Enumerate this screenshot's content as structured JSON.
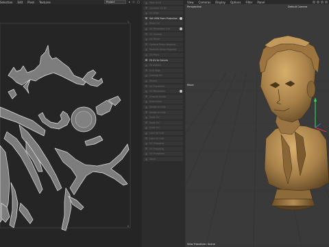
{
  "uv_editor": {
    "menu": [
      "Selection",
      "Edit",
      "Pivot",
      "Textures"
    ],
    "project_select": "Project",
    "axis_labels": {
      "top_right": "1",
      "bottom_right": "0"
    }
  },
  "command_panel": {
    "items": [
      {
        "label": "Pack to Fit",
        "active": false,
        "checked": false
      },
      {
        "label": "Conform UV Fit",
        "active": false,
        "checked": false
      },
      {
        "label": "UV Align",
        "active": false,
        "checked": false
      },
      {
        "label": "Set UVW From Projection",
        "active": true,
        "checked": true
      },
      {
        "label": "Relax UV",
        "active": false,
        "checked": false
      },
      {
        "label": "UV Relaxation Cut",
        "active": false,
        "checked": true
      },
      {
        "label": "UV Unwrap",
        "active": false,
        "checked": false
      },
      {
        "label": "UV Mirror",
        "active": false,
        "checked": false
      },
      {
        "label": "Optimal Relax Mapping",
        "active": false,
        "checked": false
      },
      {
        "label": "Realistic Relax Mapping",
        "active": false,
        "checked": false
      },
      {
        "label": "UV Paint",
        "active": false,
        "checked": false
      },
      {
        "label": "Fit UV to Canvas",
        "active": true,
        "checked": false
      },
      {
        "label": "Straighten",
        "active": false,
        "checked": false
      },
      {
        "label": "Grid Align",
        "active": false,
        "checked": false
      },
      {
        "label": "Overlap UV",
        "active": false,
        "checked": false
      },
      {
        "label": "Rotate",
        "active": false,
        "checked": false
      },
      {
        "label": "UV Transform",
        "active": false,
        "checked": false
      },
      {
        "label": "UV Relaxation",
        "active": false,
        "checked": true
      },
      {
        "label": "Unwrap Quads",
        "active": false,
        "checked": false
      },
      {
        "label": "Interactive",
        "active": false,
        "checked": false
      },
      {
        "label": "Rotate to Grid",
        "active": false,
        "checked": false
      },
      {
        "label": "Rotate to Grid",
        "active": false,
        "checked": false
      },
      {
        "label": "Scale UV",
        "active": false,
        "checked": false
      },
      {
        "label": "Scale UV",
        "active": false,
        "checked": false
      },
      {
        "label": "Scale UV",
        "active": false,
        "checked": false
      },
      {
        "label": "Lock UV Grid",
        "active": false,
        "checked": false
      },
      {
        "label": "Lock UV Grid",
        "active": false,
        "checked": false
      },
      {
        "label": "UV Snapping",
        "active": false,
        "checked": false
      },
      {
        "label": "UV Snapping",
        "active": false,
        "checked": false
      },
      {
        "label": "UV Transform",
        "active": false,
        "checked": false
      },
      {
        "label": "Stitch",
        "active": false,
        "checked": false
      }
    ]
  },
  "viewport": {
    "menu": [
      "View",
      "Cameras",
      "Display",
      "Options",
      "Filter",
      "Panel"
    ],
    "view_name": "Perspective",
    "camera": "Default Camera",
    "move_label": "Move",
    "status_text": "View Transform: Scene"
  },
  "colors": {
    "uv_background": "#252526",
    "uv_island_fill": "#7a7a7a",
    "uv_island_stroke": "#e6e6e6",
    "bust_color": "#a8814a",
    "viewport_background": "#3a3a3b",
    "axis_green": "#2ee85a",
    "axis_red": "#e23b3b"
  },
  "icons": {
    "cmd_check": "check-dot-icon",
    "uv_tools": "uv-tool-icon"
  }
}
